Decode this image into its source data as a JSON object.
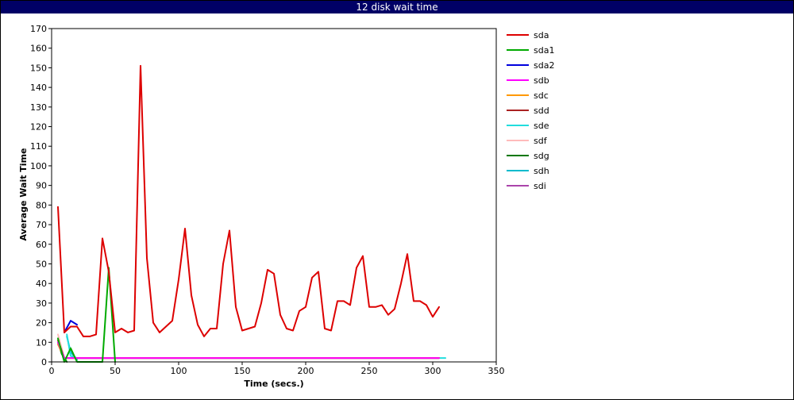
{
  "chart_data": {
    "type": "line",
    "title": "12 disk wait time",
    "xlabel": "Time (secs.)",
    "ylabel": "Average Wait Time",
    "xlim": [
      0,
      350
    ],
    "ylim": [
      0,
      170
    ],
    "xticks": [
      0,
      50,
      100,
      150,
      200,
      250,
      300,
      350
    ],
    "yticks": [
      0,
      10,
      20,
      30,
      40,
      50,
      60,
      70,
      80,
      90,
      100,
      110,
      120,
      130,
      140,
      150,
      160,
      170
    ],
    "grid": true,
    "legend": "right",
    "series": [
      {
        "name": "sda",
        "color": "#dd0000",
        "x": [
          5,
          10,
          15,
          20,
          25,
          30,
          35,
          40,
          45,
          50,
          55,
          60,
          65,
          70,
          75,
          80,
          85,
          90,
          95,
          100,
          105,
          110,
          115,
          120,
          125,
          130,
          135,
          140,
          145,
          150,
          155,
          160,
          165,
          170,
          175,
          180,
          185,
          190,
          195,
          200,
          205,
          210,
          215,
          220,
          225,
          230,
          235,
          240,
          245,
          250,
          255,
          260,
          265,
          270,
          275,
          280,
          285,
          290,
          295,
          300,
          305
        ],
        "y": [
          79,
          15,
          18,
          18,
          13,
          13,
          14,
          63,
          46,
          15,
          17,
          15,
          16,
          151,
          53,
          20,
          15,
          18,
          21,
          42,
          68,
          34,
          19,
          13,
          17,
          17,
          50,
          67,
          28,
          16,
          17,
          18,
          30,
          47,
          45,
          24,
          17,
          16,
          26,
          28,
          43,
          46,
          17,
          16,
          31,
          31,
          29,
          48,
          54,
          28,
          28,
          29,
          24,
          27,
          40,
          55,
          31,
          31,
          29,
          23,
          28
        ]
      },
      {
        "name": "sda1",
        "color": "#00aa00",
        "x": [
          5,
          10,
          15,
          20,
          25,
          30,
          35,
          40,
          45,
          50
        ],
        "y": [
          12,
          0,
          7,
          0,
          0,
          0,
          0,
          0,
          48,
          0
        ]
      },
      {
        "name": "sda2",
        "color": "#0000dd",
        "x": [
          10,
          15,
          20
        ],
        "y": [
          15,
          21,
          19
        ]
      },
      {
        "name": "sdb",
        "color": "#ff00ff",
        "x": [
          5,
          10,
          15,
          20,
          30,
          40,
          50,
          60,
          70,
          80,
          90,
          100,
          110,
          120,
          130,
          140,
          150,
          160,
          170,
          180,
          190,
          200,
          210,
          220,
          230,
          240,
          250,
          260,
          270,
          280,
          290,
          300,
          305
        ],
        "y": [
          10,
          2,
          2,
          2,
          2,
          2,
          2,
          2,
          2,
          2,
          2,
          2,
          2,
          2,
          2,
          2,
          2,
          2,
          2,
          2,
          2,
          2,
          2,
          2,
          2,
          2,
          2,
          2,
          2,
          2,
          2,
          2,
          2
        ]
      },
      {
        "name": "sdc",
        "color": "#ff9900",
        "x": [
          5,
          10,
          15,
          50,
          100,
          150,
          200,
          250,
          300,
          305
        ],
        "y": [
          9,
          2,
          2,
          2,
          2,
          2,
          2,
          2,
          2,
          2
        ]
      },
      {
        "name": "sdd",
        "color": "#aa2222",
        "x": [
          5,
          10,
          15,
          50,
          100,
          150,
          200,
          250,
          300,
          305
        ],
        "y": [
          11,
          2,
          2,
          2,
          2,
          2,
          2,
          2,
          2,
          2
        ]
      },
      {
        "name": "sde",
        "color": "#22dddd",
        "x": [
          12,
          15,
          20,
          50,
          100,
          150,
          200,
          250,
          300,
          310
        ],
        "y": [
          14,
          3,
          2,
          2,
          2,
          2,
          2,
          2,
          2,
          2
        ]
      },
      {
        "name": "sdf",
        "color": "#ffbbbb",
        "x": [
          5,
          10,
          15,
          50,
          100,
          150,
          200,
          250,
          300,
          305
        ],
        "y": [
          14,
          2,
          2,
          2,
          2,
          2,
          2,
          2,
          2,
          2
        ]
      },
      {
        "name": "sdg",
        "color": "#007700",
        "x": [
          5,
          8,
          12
        ],
        "y": [
          10,
          4,
          0
        ]
      },
      {
        "name": "sdh",
        "color": "#00bbcc",
        "x": [
          12,
          15,
          20
        ],
        "y": [
          13,
          5,
          1
        ]
      },
      {
        "name": "sdi",
        "color": "#aa44aa",
        "x": [
          5,
          10,
          15,
          50,
          100,
          150,
          200,
          250,
          300,
          305
        ],
        "y": [
          12,
          2,
          2,
          2,
          2,
          2,
          2,
          2,
          2,
          2
        ]
      }
    ]
  }
}
